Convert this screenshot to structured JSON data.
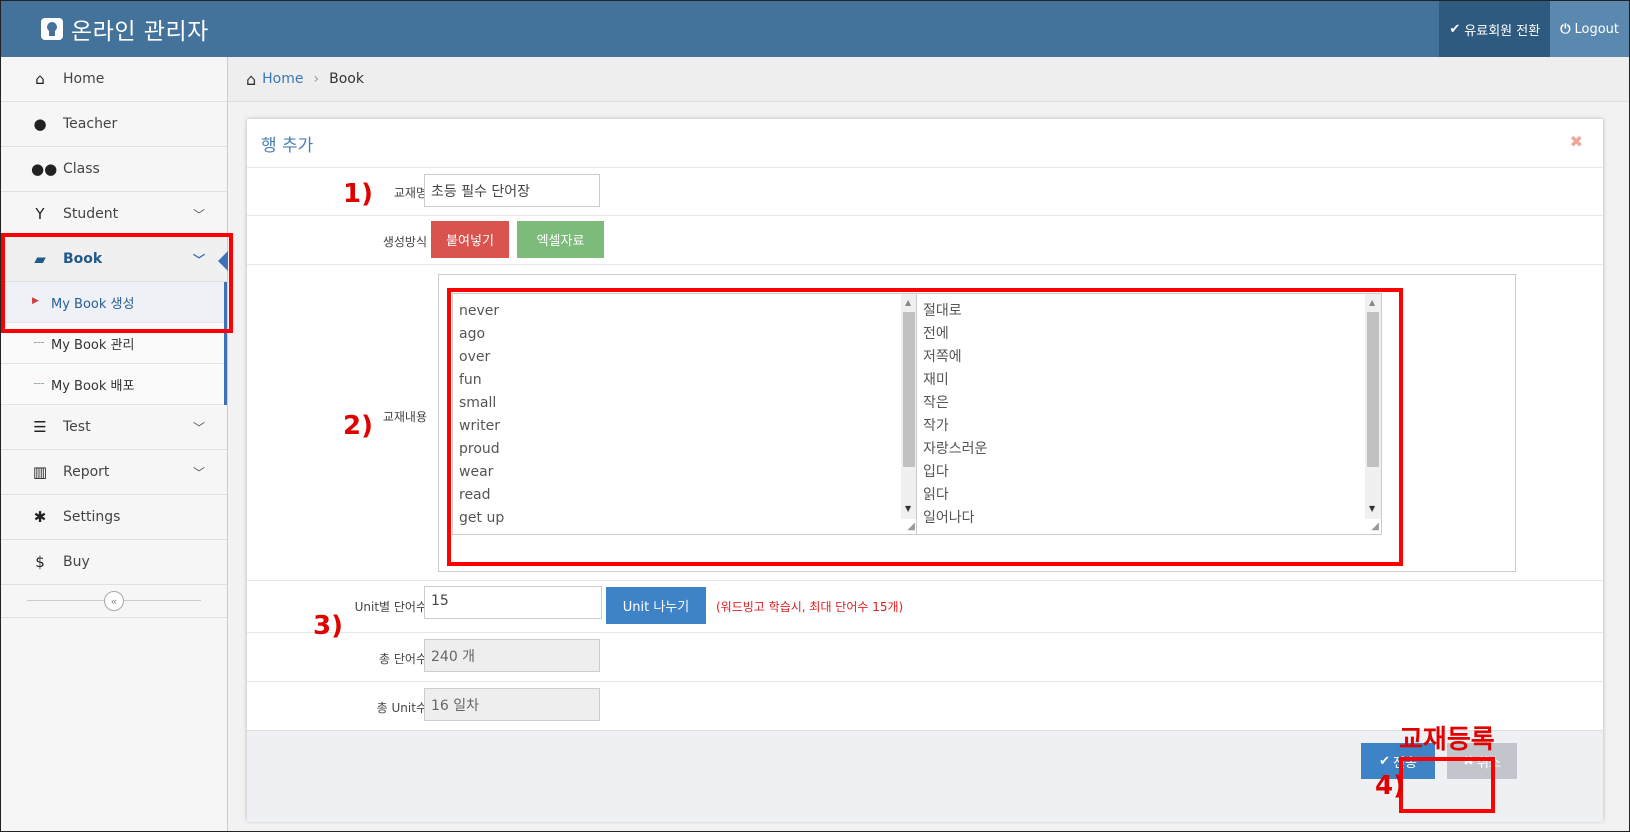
{
  "app": {
    "title": "온라인 관리자"
  },
  "topbar": {
    "paid_switch": "유료회원 전환",
    "logout": "Logout"
  },
  "sidebar": {
    "items": [
      {
        "label": "Home",
        "icon": "home-icon"
      },
      {
        "label": "Teacher",
        "icon": "user-icon"
      },
      {
        "label": "Class",
        "icon": "users-icon"
      },
      {
        "label": "Student",
        "icon": "student-icon"
      },
      {
        "label": "Book",
        "icon": "book-icon"
      },
      {
        "label": "Test",
        "icon": "list-icon"
      },
      {
        "label": "Report",
        "icon": "bar-chart-icon"
      },
      {
        "label": "Settings",
        "icon": "gear-icon"
      },
      {
        "label": "Buy",
        "icon": "dollar-icon"
      }
    ],
    "book_sub": [
      "My Book 생성",
      "My Book 관리",
      "My Book 배포"
    ]
  },
  "breadcrumb": {
    "home": "Home",
    "current": "Book"
  },
  "modal": {
    "title": "행 추가",
    "book_name_label": "교재명",
    "book_name_value": "초등 필수 단어장",
    "method_label": "생성방식",
    "paste_button": "붙여넣기",
    "excel_button": "엑셀자료",
    "content_label": "교재내용",
    "english_words": [
      "never",
      "ago",
      "over",
      "fun",
      "small",
      "writer",
      "proud",
      "wear",
      "read",
      "get up"
    ],
    "korean_words": [
      "절대로",
      "전에",
      "저쪽에",
      "재미",
      "작은",
      "작가",
      "자랑스러운",
      "입다",
      "읽다",
      "일어나다"
    ],
    "unit_words_label": "Unit별 단어수",
    "unit_words_value": "15",
    "split_button": "Unit 나누기",
    "split_note": "(워드빙고 학습시, 최대 단어수 15개)",
    "total_words_label": "총 단어수",
    "total_words_value": "240 개",
    "total_units_label": "총 Unit수",
    "total_units_value": "16 일차",
    "submit_button": "전송",
    "cancel_button": "취소"
  },
  "annotations": {
    "step1": "1)",
    "step2": "2)",
    "step3": "3)",
    "step4": "4)",
    "register_caption": "교재등록"
  }
}
